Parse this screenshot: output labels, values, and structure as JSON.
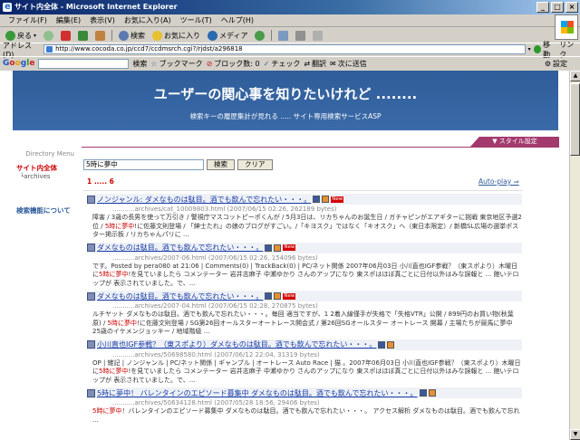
{
  "window": {
    "title": "サイト内全体 - Microsoft Internet Explorer",
    "buttons": [
      "_",
      "□",
      "×"
    ]
  },
  "menu": [
    "ファイル(F)",
    "編集(E)",
    "表示(V)",
    "お気に入り(A)",
    "ツール(T)",
    "ヘルプ(H)"
  ],
  "toolbar": {
    "back": "戻る",
    "search": "検索",
    "favorites": "お気に入り",
    "media": "メディア"
  },
  "address": {
    "label": "アドレス(D)",
    "url": "http://www.cocoda.co.jp/ccd7/ccdmsrch.cgi?/rjdst/a296818",
    "go": "移動",
    "links": "リンク"
  },
  "googlebar": {
    "logo": "Google",
    "search_btn": "検索",
    "bookmarks": "ブックマーク",
    "popup": "ブロック数: 0",
    "check": "チェック",
    "translate": "翻訳",
    "send": "次に送信",
    "settings": "設定"
  },
  "banner": {
    "title": "ユーザーの関心事を知りたいけれど ........",
    "subtitle": "検索キーの履歴集計が見れる ..... サイト専用検索サービスASP"
  },
  "style_tab": "スタイル設定",
  "sidebar": {
    "dir_menu": "Directory Menu",
    "site_all": "サイト内全体",
    "archives": "archives",
    "about": "検索機能について"
  },
  "search": {
    "value": "5時に夢中",
    "search_btn": "検索",
    "clear_btn": "クリア"
  },
  "pager": "1 ..... 6",
  "autoplay": "Auto-play ⇒",
  "results": [
    {
      "title": "ノンジャンル: ダメなものは駄目。酒でも飲んで忘れたい・・・。",
      "is_new": true,
      "url": "...........archives/cat_10009803.html (2007/06/15 02:26, 262189 bytes)",
      "snippet_before": "障害 / 3歳の長男を使って万引き / 警視庁マスコットピーポくんが / 5月3日は、リカちゃんのお誕生日 / ガチャピンがエアギターに挑戦 東京地区予選2位 / ",
      "snippet_hl": "5時に夢中",
      "snippet_after": "!に佐藤文則登場 / 「紳士たれ」の娘のブログがすごい。/「キヨスク」ではなく「キオスク」へ（東日本限定）/ 新橋SL広場の選挙ポスター掲示板 / リカちゃんパリに ..."
    },
    {
      "title": "ダメなものは駄目。酒でも飲んで忘れたい・・・。",
      "is_new": true,
      "url": "...........archives/2007-06.html (2007/06/15 02:26, 154096 bytes)",
      "snippet_before": "です。Posted by pera080 at 21:06 | Comments(0) | TrackBack(0) | PC/ネット関係 2007年06月03日 小川直也IGF参戦？（東スポより）木曜日に",
      "snippet_hl": "5時に夢中",
      "snippet_after": "!を見ていましたら コメンテーター 岩井志麻子 中瀬ゆかり さんのアップになり 東スポはほぼ真ごとに日付以外はみな誤報と ... 飽いテロップが 表示されていました。で、..."
    },
    {
      "title": "ダメなものは駄目。酒でも飲んで忘れたい・・・。",
      "is_new": true,
      "url": "...........archives/2007-04.html (2007/06/15 02:28, 270875 bytes)",
      "snippet_before": "ルチヤット ダメなものは駄目。酒でも飲んで忘れたい・・・。毎回 適当ですが、1 2着入線僅手が失格で「失格VTR」公開 / 899円のお買い物(秋葉原) / ",
      "snippet_hl": "5時に夢中",
      "snippet_after": "!に佐藤文則登場 / SG第26回オールスターオートレース開会式 / 第26回SGオールスター オートレース 開幕 / 主場たちが競馬に夢中 25歳のイケメンジョッキー / 地域階級 ..."
    },
    {
      "title": "小川直也IGF参戦？（東スポより）ダメなものは駄目。酒でも飲んで忘れたい・・・。",
      "is_new": false,
      "url": "...........archives/50698580.html (2007/06/12 22:04, 31319 bytes)",
      "snippet_before": "OP | 雑記 | ノンジャンル | PC/ネット関係 | ギャンブル | オートレース Auto Race | 猫 。2007年06月03日 小川直也IGF参戦？（東スポより）木曜日に",
      "snippet_hl": "5時に夢中",
      "snippet_after": "!を見ていましたら コメンテーター 岩井志麻子 中瀬ゆかり さんのアップになり 東スポはほぼ真ごとに日付以外はみな誤報と ... 飽いテロップが 表示されていました。で、..."
    },
    {
      "title": "5時に夢中！ バレンタインのエピソード募集中 ダメなものは駄目。酒でも飲んで忘れたい・・・。",
      "is_new": false,
      "url": "...........archives/50634128.html (2007/05/28 18:56, 29406 bytes)",
      "snippet_before": "",
      "snippet_hl": "5時に夢中",
      "snippet_after": "！バレンタインのエピソード募集中 ダメなものは駄目。酒でも飲んで忘れたい・・・。 アクセス解析 ダメなものは駄目。酒でも飲んで忘れ ..."
    }
  ]
}
